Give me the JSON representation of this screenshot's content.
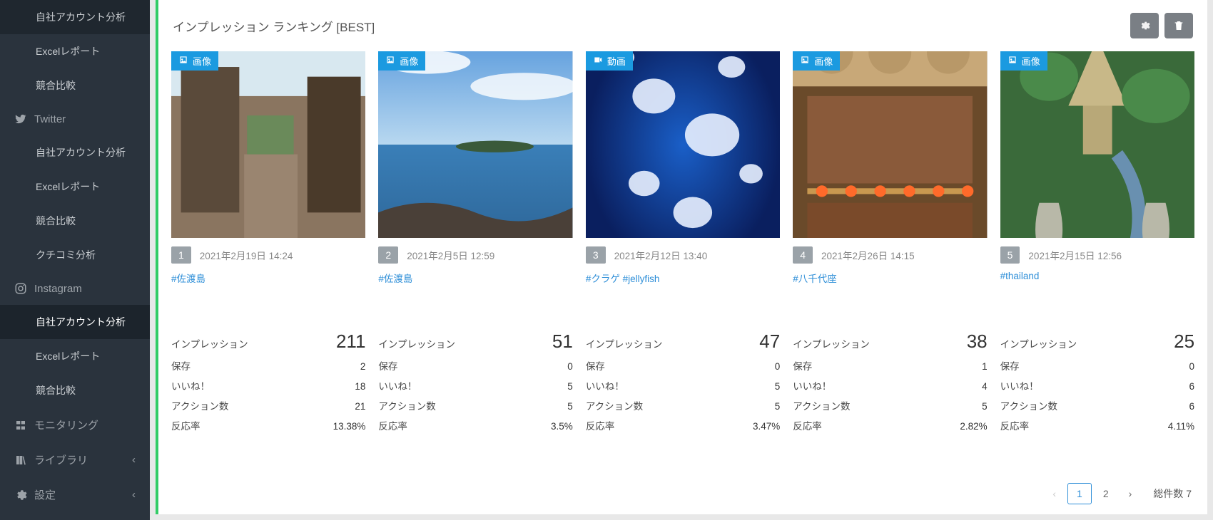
{
  "sidebar": {
    "items": [
      {
        "label": "自社アカウント分析",
        "type": "item"
      },
      {
        "label": "Excelレポート",
        "type": "item"
      },
      {
        "label": "競合比較",
        "type": "item"
      },
      {
        "label": "Twitter",
        "type": "header",
        "icon": "twitter"
      },
      {
        "label": "自社アカウント分析",
        "type": "item"
      },
      {
        "label": "Excelレポート",
        "type": "item"
      },
      {
        "label": "競合比較",
        "type": "item"
      },
      {
        "label": "クチコミ分析",
        "type": "item"
      },
      {
        "label": "Instagram",
        "type": "header",
        "icon": "instagram"
      },
      {
        "label": "自社アカウント分析",
        "type": "item",
        "active": true
      },
      {
        "label": "Excelレポート",
        "type": "item"
      },
      {
        "label": "競合比較",
        "type": "item"
      },
      {
        "label": "モニタリング",
        "type": "header",
        "icon": "monitoring"
      },
      {
        "label": "ライブラリ",
        "type": "header",
        "icon": "library",
        "chev": true
      },
      {
        "label": "設定",
        "type": "header",
        "icon": "gear",
        "chev": true
      }
    ]
  },
  "panel": {
    "title": "インプレッション ランキング [BEST]"
  },
  "stat_labels": {
    "impressions": "インプレッション",
    "saves": "保存",
    "likes": "いいね！",
    "actions": "アクション数",
    "rate": "反応率"
  },
  "media_labels": {
    "image": "画像",
    "video": "動画"
  },
  "cards": [
    {
      "rank": "1",
      "media": "image",
      "date": "2021年2月19日 14:24",
      "tags": "#佐渡島",
      "impressions": "211",
      "saves": "2",
      "likes": "18",
      "actions": "21",
      "rate": "13.38%",
      "thumb": "village"
    },
    {
      "rank": "2",
      "media": "image",
      "date": "2021年2月5日 12:59",
      "tags": "#佐渡島",
      "impressions": "51",
      "saves": "0",
      "likes": "5",
      "actions": "5",
      "rate": "3.5%",
      "thumb": "coast"
    },
    {
      "rank": "3",
      "media": "video",
      "date": "2021年2月12日 13:40",
      "tags": "#クラゲ #jellyfish",
      "impressions": "47",
      "saves": "0",
      "likes": "5",
      "actions": "5",
      "rate": "3.47%",
      "thumb": "jelly"
    },
    {
      "rank": "4",
      "media": "image",
      "date": "2021年2月26日 14:15",
      "tags": "#八千代座",
      "impressions": "38",
      "saves": "1",
      "likes": "4",
      "actions": "5",
      "rate": "2.82%",
      "thumb": "theater"
    },
    {
      "rank": "5",
      "media": "image",
      "date": "2021年2月15日 12:56",
      "tags": "#thailand",
      "impressions": "25",
      "saves": "0",
      "likes": "6",
      "actions": "6",
      "rate": "4.11%",
      "thumb": "thailand"
    }
  ],
  "pagination": {
    "prev": "‹",
    "p1": "1",
    "p2": "2",
    "next": "›",
    "total_label": "総件数 7"
  }
}
